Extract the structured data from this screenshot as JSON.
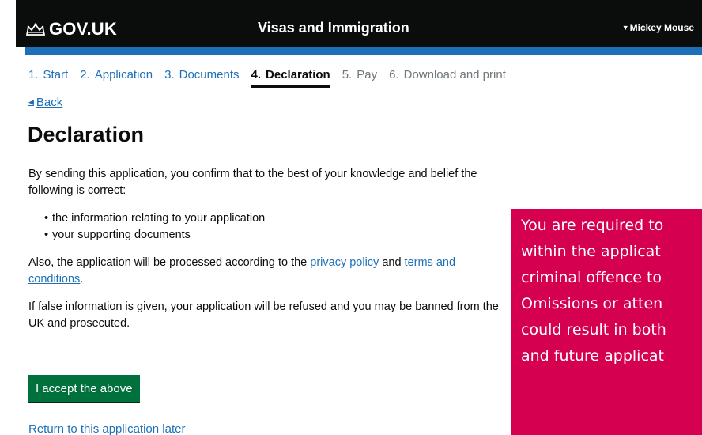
{
  "header": {
    "logo_text": "GOV.UK",
    "service_name": "Visas and Immigration",
    "user_name": "Mickey Mouse",
    "colors": {
      "bar": "#0b0c0c",
      "accent": "#1d70b8"
    }
  },
  "steps": [
    {
      "num": "1.",
      "label": "Start",
      "state": "done"
    },
    {
      "num": "2.",
      "label": "Application",
      "state": "done"
    },
    {
      "num": "3.",
      "label": "Documents",
      "state": "done"
    },
    {
      "num": "4.",
      "label": "Declaration",
      "state": "current"
    },
    {
      "num": "5.",
      "label": "Pay",
      "state": "future"
    },
    {
      "num": "6.",
      "label": "Download and print",
      "state": "future"
    }
  ],
  "back_label": "Back",
  "page_title": "Declaration",
  "intro": "By sending this application, you confirm that to the best of your knowledge and belief the following is correct:",
  "bullets": [
    "the information relating to your application",
    "your supporting documents"
  ],
  "policy": {
    "text_before": "Also, the application will be processed according to the ",
    "privacy_link": "privacy policy",
    "text_and": " and ",
    "terms_link": "terms and conditions",
    "text_after": "."
  },
  "warning_text": "If false information is given, your application will be refused and you may be banned from the UK and prosecuted.",
  "accept_button": "I accept the above",
  "return_link": "Return to this application later",
  "overlay": {
    "lines": [
      "You are required to",
      "within the applicat",
      "criminal offence to",
      "Omissions or atten",
      "could result in both",
      "and future applicat"
    ],
    "color": "#d5004f"
  }
}
